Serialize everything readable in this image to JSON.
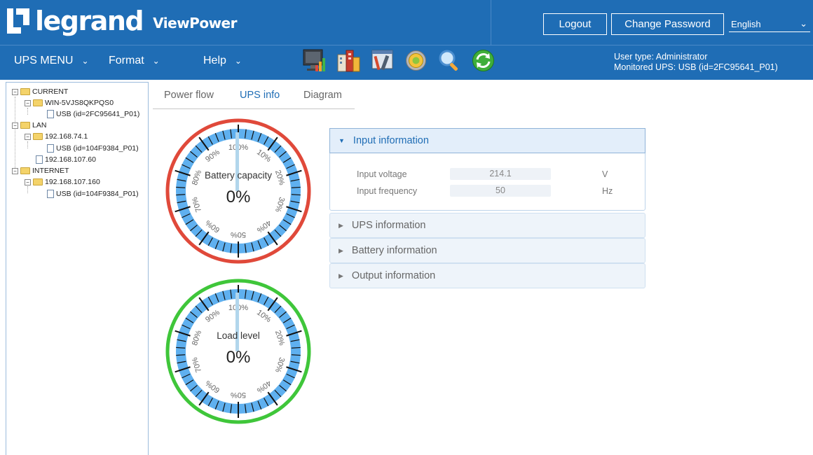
{
  "header": {
    "brand": "legrand",
    "product": "ViewPower",
    "logout_label": "Logout",
    "change_password_label": "Change Password",
    "language": "English",
    "user_type": "User type: Administrator",
    "monitored_ups": "Monitored UPS: USB (id=2FC95641_P01)",
    "colors": {
      "header_bg": "#1f6db5",
      "text": "#ffffff"
    }
  },
  "menu": {
    "ups_menu": "UPS MENU",
    "format": "Format",
    "help": "Help"
  },
  "toolbar": {
    "icons": [
      "monitor-chart-icon",
      "buildings-icon",
      "tools-window-icon",
      "settings-disc-icon",
      "magnifier-icon",
      "refresh-icon"
    ]
  },
  "tree": {
    "current": "CURRENT",
    "current_host": "WIN-5VJS8QKPQS0",
    "current_device": "USB (id=2FC95641_P01)",
    "lan": "LAN",
    "lan_host1": "192.168.74.1",
    "lan_host1_device": "USB (id=104F9384_P01)",
    "lan_host2": "192.168.107.60",
    "internet": "INTERNET",
    "internet_host": "192.168.107.160",
    "internet_device": "USB (id=104F9384_P01)"
  },
  "tabs": {
    "power_flow": "Power flow",
    "ups_info": "UPS info",
    "diagram": "Diagram",
    "active": "ups_info"
  },
  "gauges": {
    "battery": {
      "label": "Battery capacity",
      "value_text": "0%",
      "value": 0,
      "ring_color": "#e0493a"
    },
    "load": {
      "label": "Load level",
      "value_text": "0%",
      "value": 0,
      "ring_color": "#3fc63a"
    },
    "scale_labels": [
      "100%",
      "10%",
      "20%",
      "30%",
      "40%",
      "50%",
      "60%",
      "70%",
      "80%",
      "90%"
    ]
  },
  "panels": {
    "input": {
      "title": "Input information",
      "voltage_label": "Input voltage",
      "voltage_value": "214.1",
      "voltage_unit": "V",
      "frequency_label": "Input frequency",
      "frequency_value": "50",
      "frequency_unit": "Hz"
    },
    "ups": {
      "title": "UPS information"
    },
    "battery": {
      "title": "Battery information"
    },
    "output": {
      "title": "Output information"
    }
  }
}
